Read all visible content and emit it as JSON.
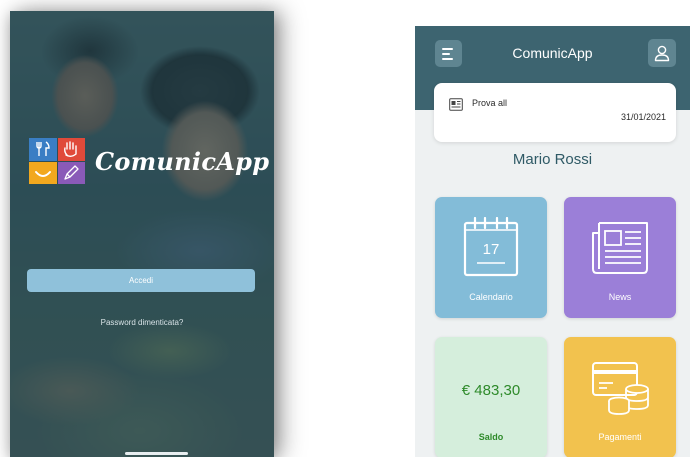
{
  "login_screen": {
    "app_name": "ComunicApp",
    "login_button": "Accedi",
    "forgot_password": "Password dimenticata?"
  },
  "dashboard": {
    "header": {
      "title": "ComunicApp"
    },
    "notice": {
      "title": "Prova all",
      "date": "31/01/2021"
    },
    "user_name": "Mario Rossi",
    "tiles": {
      "calendar": {
        "label": "Calendario",
        "day": "17",
        "color": "#83bcd8"
      },
      "news": {
        "label": "News",
        "color": "#9b7fd8"
      },
      "balance": {
        "label": "Saldo",
        "value": "€ 483,30",
        "color": "#d5eedc"
      },
      "payments": {
        "label": "Pagamenti",
        "color": "#f2c24e"
      }
    }
  },
  "colors": {
    "header": "#3d6470",
    "accent_button": "#8fc1da",
    "balance_text": "#2e8a2a"
  }
}
